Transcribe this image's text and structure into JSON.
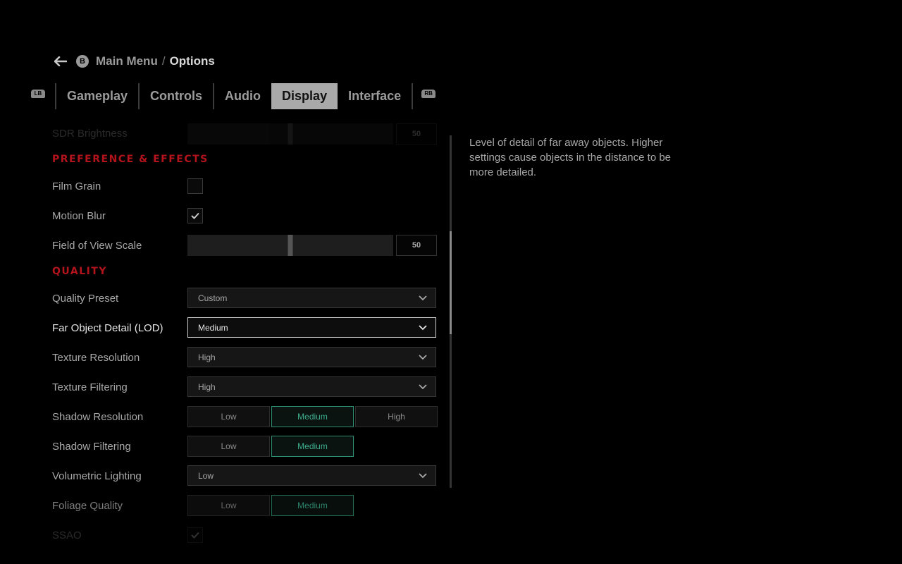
{
  "breadcrumb": {
    "back_button_glyph": "B",
    "parent": "Main Menu",
    "separator": "/",
    "current": "Options"
  },
  "tabs": {
    "left_bumper": "LB",
    "right_bumper": "RB",
    "items": [
      {
        "label": "Gameplay"
      },
      {
        "label": "Controls"
      },
      {
        "label": "Audio"
      },
      {
        "label": "Display",
        "active": true
      },
      {
        "label": "Interface"
      }
    ]
  },
  "settings": {
    "sdr_brightness": {
      "label": "SDR Brightness",
      "value": "50",
      "level": 0.5
    },
    "section_preference": "PREFERENCE & EFFECTS",
    "film_grain": {
      "label": "Film Grain",
      "checked": false
    },
    "motion_blur": {
      "label": "Motion Blur",
      "checked": true
    },
    "fov_scale": {
      "label": "Field of View Scale",
      "value": "50",
      "level": 0.5
    },
    "section_quality": "QUALITY",
    "quality_preset": {
      "label": "Quality Preset",
      "value": "Custom"
    },
    "far_object_detail": {
      "label": "Far Object Detail (LOD)",
      "value": "Medium"
    },
    "texture_resolution": {
      "label": "Texture Resolution",
      "value": "High"
    },
    "texture_filtering": {
      "label": "Texture Filtering",
      "value": "High"
    },
    "shadow_resolution": {
      "label": "Shadow Resolution",
      "options": [
        "Low",
        "Medium",
        "High"
      ],
      "selected": "Medium"
    },
    "shadow_filtering": {
      "label": "Shadow Filtering",
      "options": [
        "Low",
        "Medium"
      ],
      "selected": "Medium"
    },
    "volumetric_lighting": {
      "label": "Volumetric Lighting",
      "value": "Low"
    },
    "foliage_quality": {
      "label": "Foliage Quality",
      "options": [
        "Low",
        "Medium"
      ],
      "selected": "Medium"
    },
    "ssao": {
      "label": "SSAO",
      "checked": true
    }
  },
  "description": "Level of detail of far away objects. Higher settings cause objects in the distance to be more detailed.",
  "colors": {
    "section_title": "#b3131b",
    "selected_option": "#3fae8d",
    "active_tab_bg": "#a9a9a9"
  },
  "icons": {
    "back": "left-arrow-icon",
    "dropdown": "chevron-down-icon",
    "check": "checkmark-icon"
  }
}
